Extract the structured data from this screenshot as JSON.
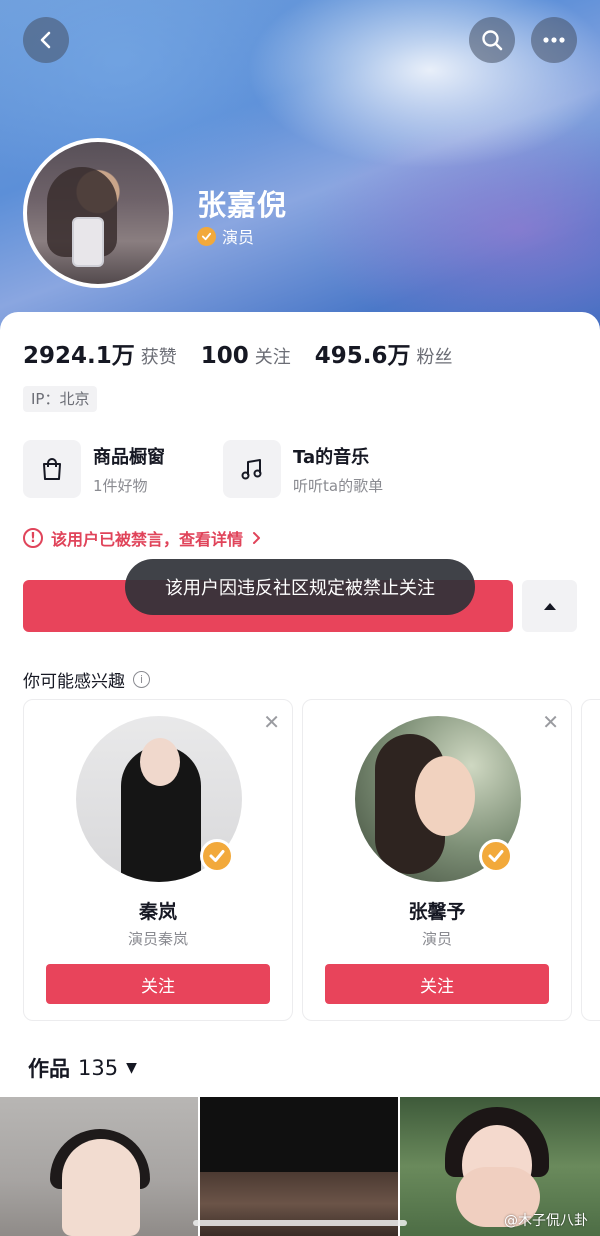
{
  "header": {
    "name": "张嘉倪",
    "verify_label": "演员",
    "icons": {
      "back": "chevron-left-icon",
      "search": "search-icon",
      "more": "more-dots-icon"
    }
  },
  "stats": [
    {
      "num": "2924.1万",
      "label": "获赞"
    },
    {
      "num": "100",
      "label": "关注"
    },
    {
      "num": "495.6万",
      "label": "粉丝"
    }
  ],
  "ip_tag": "IP：北京",
  "features": {
    "shop": {
      "title": "商品橱窗",
      "sub": "1件好物",
      "icon": "shopping-bag-icon"
    },
    "music": {
      "title": "Ta的音乐",
      "sub": "听听ta的歌单",
      "icon": "music-note-icon"
    }
  },
  "banned_notice": "该用户已被禁言，查看详情",
  "toast": "该用户因违反社区规定被禁止关注",
  "suggest": {
    "title": "你可能感兴趣",
    "cards": [
      {
        "name": "秦岚",
        "sub": "演员秦岚",
        "follow": "关注"
      },
      {
        "name": "张馨予",
        "sub": "演员",
        "follow": "关注"
      }
    ]
  },
  "works": {
    "label": "作品",
    "count": "135"
  },
  "watermark": "@木子侃八卦",
  "colors": {
    "accent": "#e8445b",
    "verified": "#f2a93b",
    "banner": "#5c8fd8"
  }
}
